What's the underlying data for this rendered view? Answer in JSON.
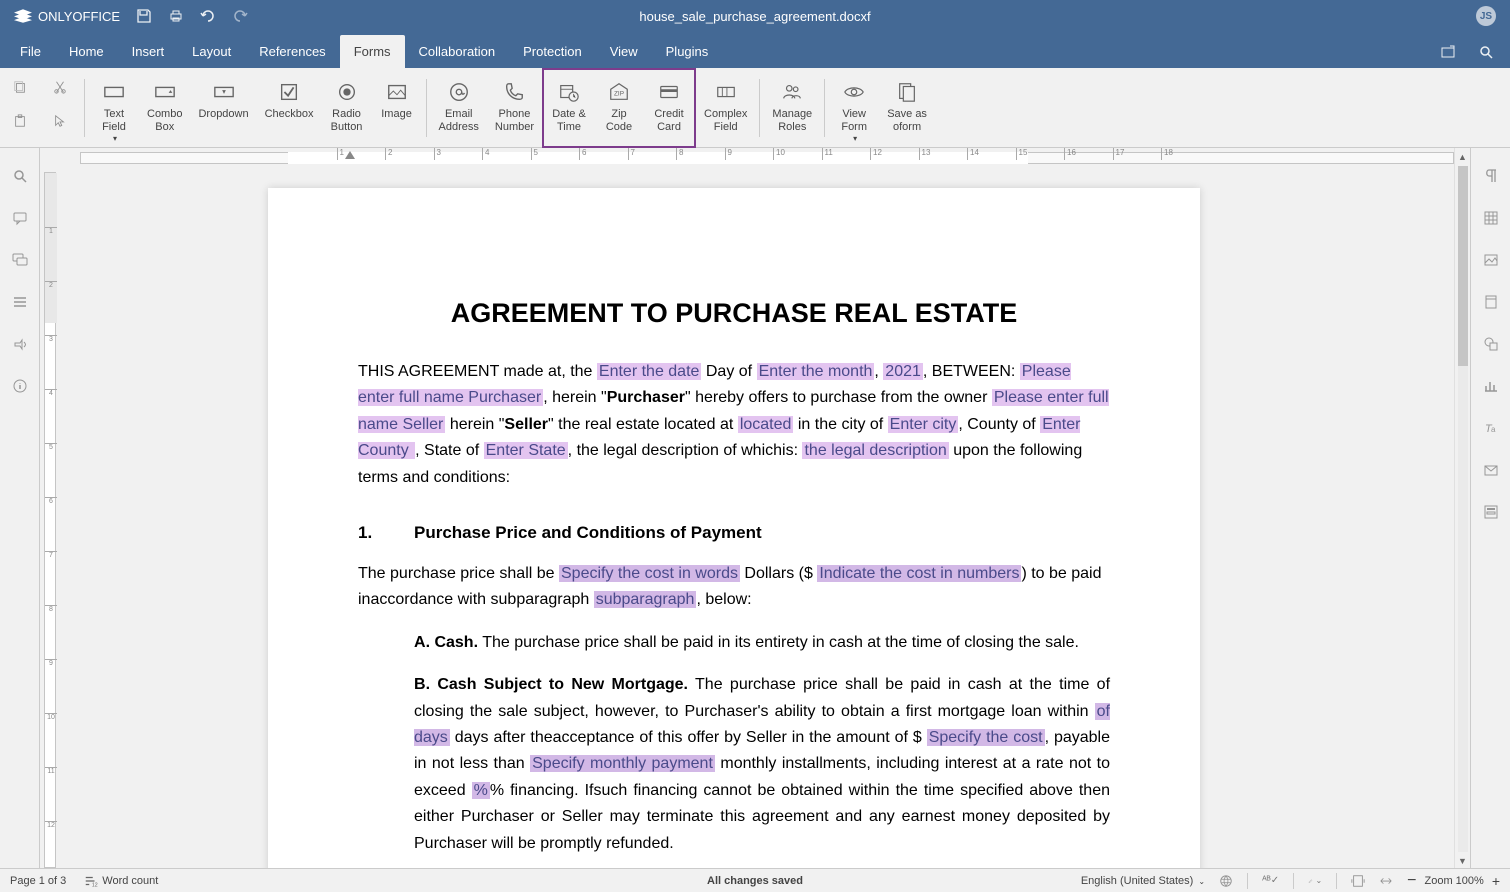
{
  "titlebar": {
    "logo": "ONLYOFFICE",
    "filename": "house_sale_purchase_agreement.docxf",
    "avatar_initials": "JS"
  },
  "menu": {
    "file": "File",
    "home": "Home",
    "insert": "Insert",
    "layout": "Layout",
    "references": "References",
    "forms": "Forms",
    "collaboration": "Collaboration",
    "protection": "Protection",
    "view": "View",
    "plugins": "Plugins"
  },
  "ribbon": {
    "text_field": "Text\nField",
    "combo_box": "Combo\nBox",
    "dropdown": "Dropdown",
    "checkbox": "Checkbox",
    "radio_button": "Radio\nButton",
    "image": "Image",
    "email_address": "Email\nAddress",
    "phone_number": "Phone\nNumber",
    "date_time": "Date &\nTime",
    "zip_code": "Zip\nCode",
    "credit_card": "Credit\nCard",
    "complex_field": "Complex\nField",
    "manage_roles": "Manage\nRoles",
    "view_form": "View\nForm",
    "save_as_oform": "Save as\noform"
  },
  "document": {
    "title": "AGREEMENT TO PURCHASE REAL ESTATE",
    "para1_a": "THIS AGREEMENT made at, the  ",
    "field_date": "Enter the date",
    "para1_b": " Day of ",
    "field_month": "Enter the month",
    "para1_c": ", ",
    "field_year": "2021",
    "para1_d": ", BETWEEN: ",
    "field_purchaser": "Please enter full name Purchaser",
    "para1_e": ", herein \"",
    "bold_purchaser": "Purchaser",
    "para1_f": "\" hereby offers to purchase from the owner ",
    "field_seller": "Please enter full name Seller",
    "para1_g": " herein \"",
    "bold_seller": "Seller",
    "para1_h": "\" the real estate located at ",
    "field_located": "located",
    "para1_i": " in the city of ",
    "field_city": "Enter city",
    "para1_j": ", County of ",
    "field_county": "Enter County ",
    "para1_k": ",  State of ",
    "field_state": "Enter State",
    "para1_l": ", the legal description of whichis: ",
    "field_legal": "the legal description",
    "para1_m": " upon the following terms and conditions:",
    "sec1_num": "1.",
    "sec1_title": "Purchase Price and Conditions of Payment",
    "sec1_p_a": "The purchase price shall be ",
    "field_words": "Specify the cost in words",
    "sec1_p_b": " Dollars ($ ",
    "field_numbers": "Indicate the cost in numbers",
    "sec1_p_c": ") to be paid inaccordance with subparagraph ",
    "field_subpara": "subparagraph",
    "sec1_p_d": ", below:",
    "subA_label": "A",
    "subA_bold": "Cash.",
    "subA_text": " The purchase price shall be paid in its entirety in cash at the time of closing the sale.",
    "subB_label": "B",
    "subB_bold": "Cash Subject to New Mortgage.",
    "subB_text_a": " The purchase price shall be paid in cash at the time of closing the sale subject, however, to Purchaser's ability to obtain a first mortgage loan within ",
    "field_days": "of days",
    "subB_text_b": " days after theacceptance of this offer by Seller in the amount of $ ",
    "field_cost": "Specify the cost",
    "subB_text_c": ", payable in not less than ",
    "field_monthly": "Specify monthly payment",
    "subB_text_d": " monthly installments, including interest at a rate not to exceed ",
    "field_pct": "%",
    "subB_text_e": "% financing. Ifsuch financing cannot be obtained within the time specified above then either Purchaser or Seller may terminate this agreement and any earnest money deposited by Purchaser will be promptly refunded."
  },
  "statusbar": {
    "page": "Page 1 of 3",
    "wordcount": "Word count",
    "saved": "All changes saved",
    "lang": "English (United States)",
    "zoom": "Zoom 100%"
  }
}
